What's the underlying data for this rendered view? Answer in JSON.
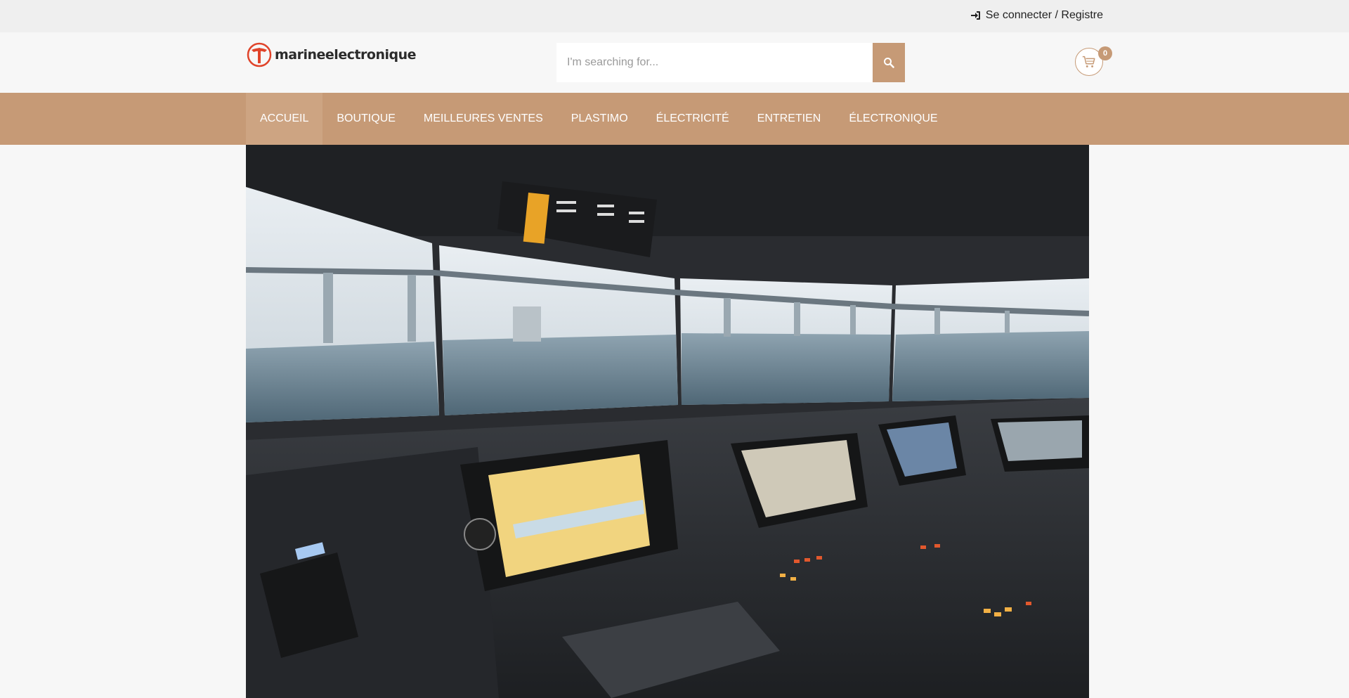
{
  "topbar": {
    "login_icon": "sign-in-icon",
    "login_label": "Se connecter / Registre"
  },
  "header": {
    "logo_text": "marineelectronique",
    "logo_icon": "anchor-logo-icon",
    "search": {
      "placeholder": "I'm searching for...",
      "value": "",
      "button_icon": "search-icon"
    },
    "cart": {
      "icon": "cart-icon",
      "count": "0"
    }
  },
  "nav": {
    "items": [
      {
        "label": "ACCUEIL",
        "active": true
      },
      {
        "label": "BOUTIQUE"
      },
      {
        "label": "MEILLEURES VENTES"
      },
      {
        "label": "PLASTIMO"
      },
      {
        "label": "ÉLECTRICITÉ"
      },
      {
        "label": "ENTRETIEN"
      },
      {
        "label": "ÉLECTRONIQUE"
      }
    ]
  },
  "hero": {
    "image": "ship-bridge-simulator-photo"
  },
  "colors": {
    "accent": "#c69a76",
    "topbar_bg": "#efefef",
    "page_bg": "#f7f7f7"
  }
}
